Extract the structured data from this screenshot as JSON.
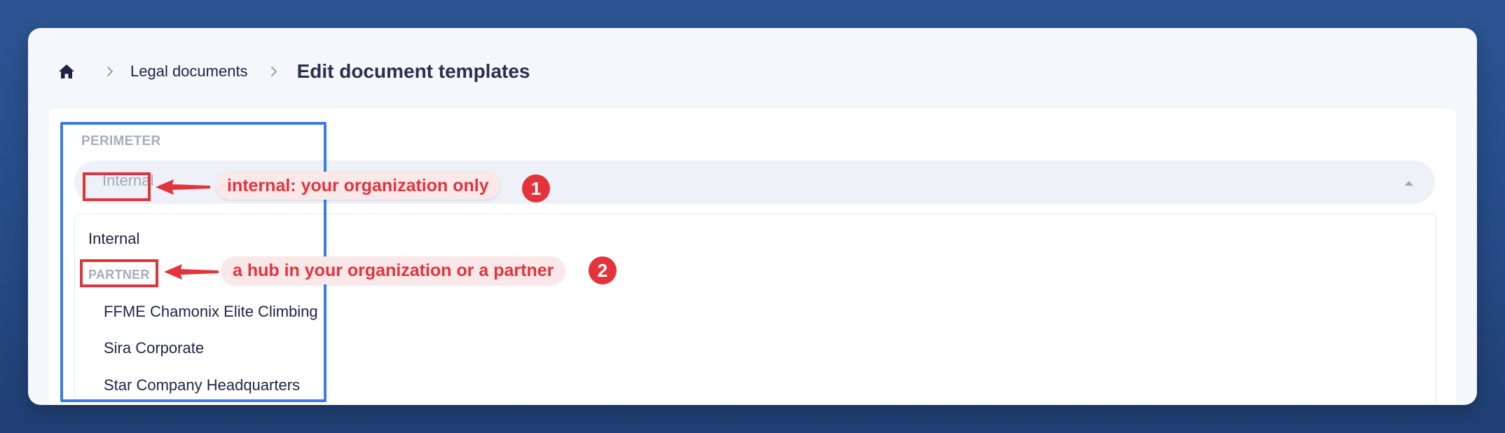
{
  "breadcrumb": {
    "home_icon": "home-icon",
    "separator_icon": "chevron-right-icon",
    "parent": "Legal documents",
    "current": "Edit document templates"
  },
  "form": {
    "perimeter_label": "PERIMETER",
    "selected_value": "Internal",
    "caret_icon": "caret-up-icon"
  },
  "dropdown": {
    "option_internal": "Internal",
    "group_label": "PARTNER",
    "partners": [
      "FFME Chamonix Elite Climbing",
      "Sira Corporate",
      "Star Company Headquarters"
    ]
  },
  "annotations": {
    "note_1": "internal: your organization only",
    "badge_1": "1",
    "note_2": "a hub in your organization or a partner",
    "badge_2": "2"
  },
  "colors": {
    "background": "#2d5593",
    "annotation_red": "#e3343d",
    "annotation_blue": "#3a7be6",
    "text_dark": "#1f2446",
    "label_gray": "#a6adbf"
  }
}
